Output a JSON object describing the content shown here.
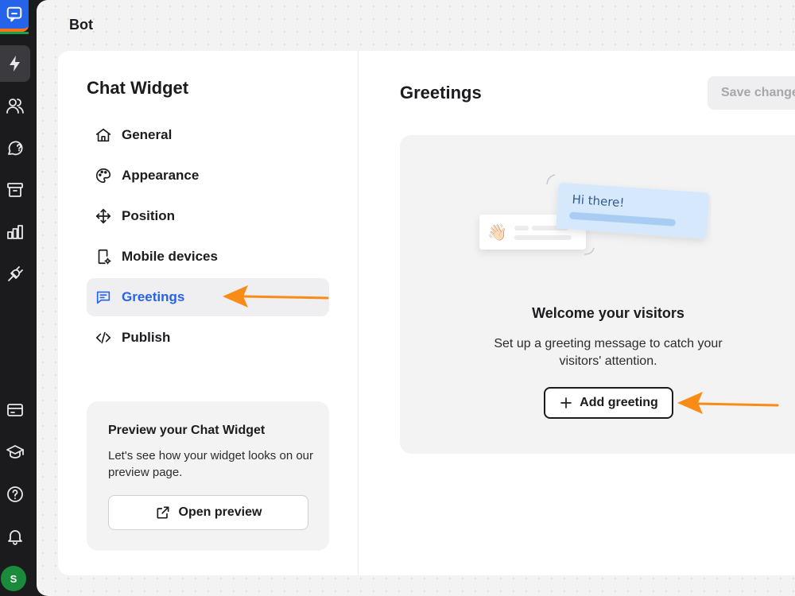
{
  "page": {
    "title": "Bot"
  },
  "rail": {
    "avatar_initial": "S",
    "items": [
      {
        "icon": "bolt-icon"
      },
      {
        "icon": "users-icon"
      },
      {
        "icon": "chat-question-icon"
      },
      {
        "icon": "archive-icon"
      },
      {
        "icon": "bar-chart-icon"
      },
      {
        "icon": "plug-icon"
      },
      {
        "icon": "billing-icon"
      },
      {
        "icon": "graduation-cap-icon"
      },
      {
        "icon": "help-icon"
      },
      {
        "icon": "bell-icon"
      }
    ]
  },
  "settings": {
    "section_title": "Chat Widget",
    "menu": [
      {
        "label": "General",
        "icon": "home-icon"
      },
      {
        "label": "Appearance",
        "icon": "palette-icon"
      },
      {
        "label": "Position",
        "icon": "move-icon"
      },
      {
        "label": "Mobile devices",
        "icon": "mobile-settings-icon"
      },
      {
        "label": "Greetings",
        "icon": "message-icon",
        "active": true
      },
      {
        "label": "Publish",
        "icon": "code-icon"
      }
    ],
    "preview": {
      "title": "Preview your Chat Widget",
      "text": "Let's see how your widget looks on our preview page.",
      "button_label": "Open preview"
    }
  },
  "greetings": {
    "title": "Greetings",
    "save_label": "Save changes",
    "illustration_text": "Hi there!",
    "illustration_emoji": "👋🏻",
    "empty_title": "Welcome your visitors",
    "empty_text": "Set up a greeting message to catch your visitors' attention.",
    "add_label": "Add greeting"
  },
  "colors": {
    "accent": "#2563eb",
    "annotation_arrow": "#f98c17",
    "rail_background": "#1b1b1e"
  }
}
